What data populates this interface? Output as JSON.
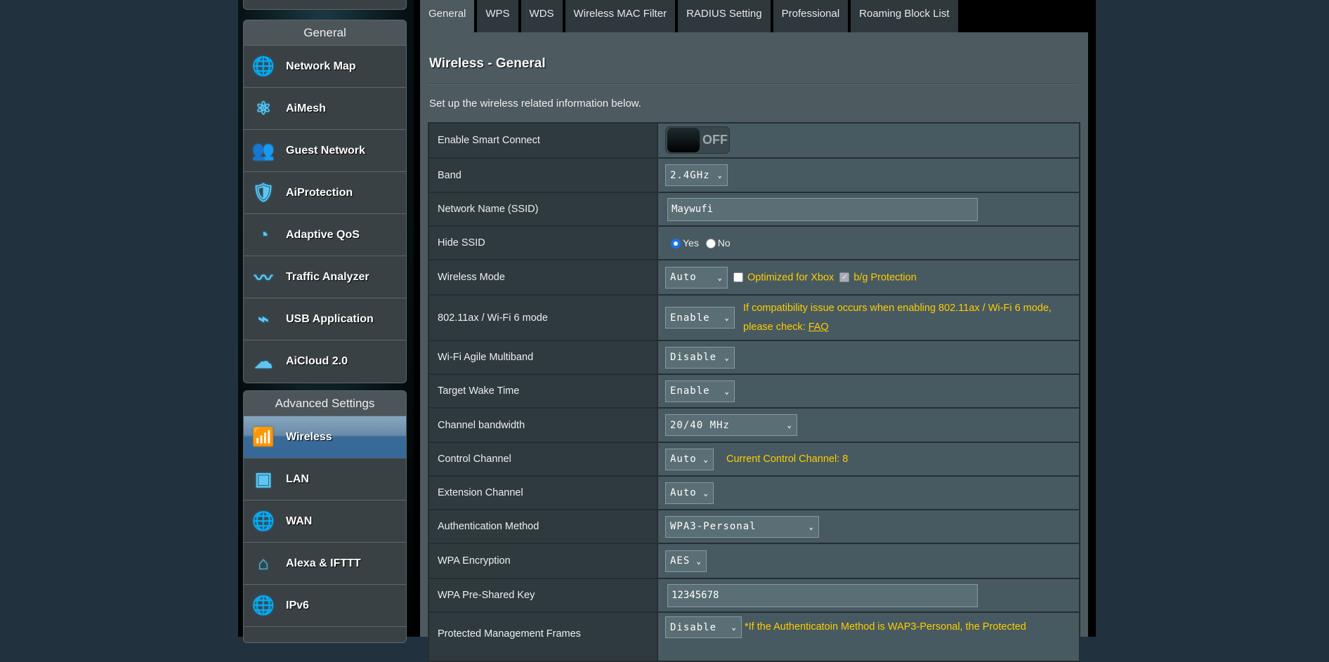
{
  "sidebar": {
    "general_header": "General",
    "general_items": [
      {
        "label": "Network Map",
        "icon": "globe-pin-icon"
      },
      {
        "label": "AiMesh",
        "icon": "mesh-icon"
      },
      {
        "label": "Guest Network",
        "icon": "guest-network-icon"
      },
      {
        "label": "AiProtection",
        "icon": "shield-lock-icon"
      },
      {
        "label": "Adaptive QoS",
        "icon": "gauge-icon"
      },
      {
        "label": "Traffic Analyzer",
        "icon": "pulse-icon"
      },
      {
        "label": "USB Application",
        "icon": "usb-icon"
      },
      {
        "label": "AiCloud 2.0",
        "icon": "cloud-icon"
      }
    ],
    "advanced_header": "Advanced Settings",
    "advanced_items": [
      {
        "label": "Wireless",
        "icon": "wifi-icon",
        "active": true
      },
      {
        "label": "LAN",
        "icon": "ethernet-port-icon"
      },
      {
        "label": "WAN",
        "icon": "globe-icon"
      },
      {
        "label": "Alexa & IFTTT",
        "icon": "smart-home-icon"
      },
      {
        "label": "IPv6",
        "icon": "ipv6-globe-icon"
      }
    ]
  },
  "tabs": [
    "General",
    "WPS",
    "WDS",
    "Wireless MAC Filter",
    "RADIUS Setting",
    "Professional",
    "Roaming Block List"
  ],
  "active_tab": "General",
  "main": {
    "title": "Wireless - General",
    "description": "Set up the wireless related information below.",
    "rows": {
      "smart_connect": {
        "label": "Enable Smart Connect",
        "state": "OFF"
      },
      "band": {
        "label": "Band",
        "value": "2.4GHz"
      },
      "ssid": {
        "label": "Network Name (SSID)",
        "value": "Maywufi"
      },
      "hide_ssid": {
        "label": "Hide SSID",
        "yes": "Yes",
        "no": "No",
        "selected": "Yes"
      },
      "wireless_mode": {
        "label": "Wireless Mode",
        "value": "Auto",
        "xbox": "Optimized for Xbox",
        "bg": "b/g Protection"
      },
      "ax_mode": {
        "label": "802.11ax / Wi-Fi 6 mode",
        "value": "Enable",
        "note": "If compatibility issue occurs when enabling 802.11ax / Wi-Fi 6 mode,",
        "note2": "please check: ",
        "link": "FAQ"
      },
      "agile": {
        "label": "Wi-Fi Agile Multiband",
        "value": "Disable"
      },
      "twt": {
        "label": "Target Wake Time",
        "value": "Enable"
      },
      "bandwidth": {
        "label": "Channel bandwidth",
        "value": "20/40 MHz"
      },
      "control": {
        "label": "Control Channel",
        "value": "Auto",
        "note": "Current Control Channel: 8"
      },
      "extension": {
        "label": "Extension Channel",
        "value": "Auto"
      },
      "auth": {
        "label": "Authentication Method",
        "value": "WPA3-Personal"
      },
      "encryption": {
        "label": "WPA Encryption",
        "value": "AES"
      },
      "psk": {
        "label": "WPA Pre-Shared Key",
        "value": "12345678"
      },
      "pmf": {
        "label": "Protected Management Frames",
        "value": "Disable",
        "note": "*If the Authenticatoin Method is WAP3-Personal, the Protected"
      }
    }
  },
  "colors": {
    "accent_yellow": "#ffcc00",
    "active_nav": "#35689a",
    "background": "#21313e"
  }
}
